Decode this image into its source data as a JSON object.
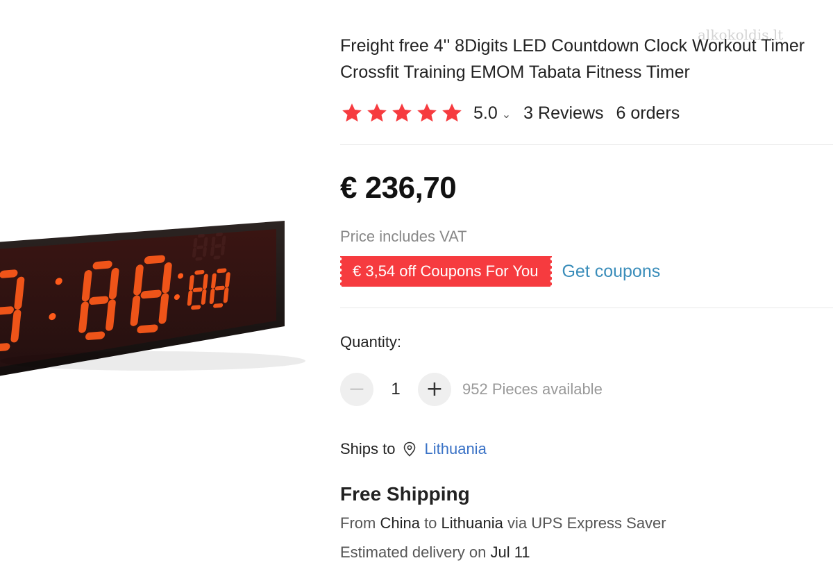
{
  "product": {
    "title_line1": "Freight free 4'' 8Digits LED Countdown Clock Workout Timer",
    "title_line2": "Crossfit Training EMOM Tabata Fitness Timer",
    "watermark": "alkokoldis.lt",
    "clock_display": {
      "main_digits": "88:88",
      "small_digits": "00",
      "digit_color": "#ff5a1a"
    }
  },
  "rating": {
    "stars": 5,
    "value": "5.0",
    "reviews": "3 Reviews",
    "orders": "6 orders",
    "star_color": "#f63b3f",
    "icon": "chevron-down-icon"
  },
  "price": {
    "amount": "€ 236,70",
    "vat_note": "Price includes VAT"
  },
  "coupon": {
    "badge_text": "€ 3,54 off Coupons For You",
    "link_text": "Get coupons",
    "badge_color": "#f63b3f",
    "link_color": "#3a8dba"
  },
  "quantity": {
    "label": "Quantity:",
    "value": "1",
    "minus": "−",
    "plus": "+",
    "available": "952 Pieces available"
  },
  "shipping": {
    "ships_to_label": "Ships to",
    "country": "Lithuania",
    "title": "Free Shipping",
    "route_prefix": "From",
    "route_origin": "China",
    "route_to": "to",
    "route_destination": "Lithuania",
    "route_via": "via UPS Express Saver",
    "delivery_prefix": "Estimated delivery on",
    "delivery_date": "Jul 11",
    "icon": "location-pin-icon"
  }
}
